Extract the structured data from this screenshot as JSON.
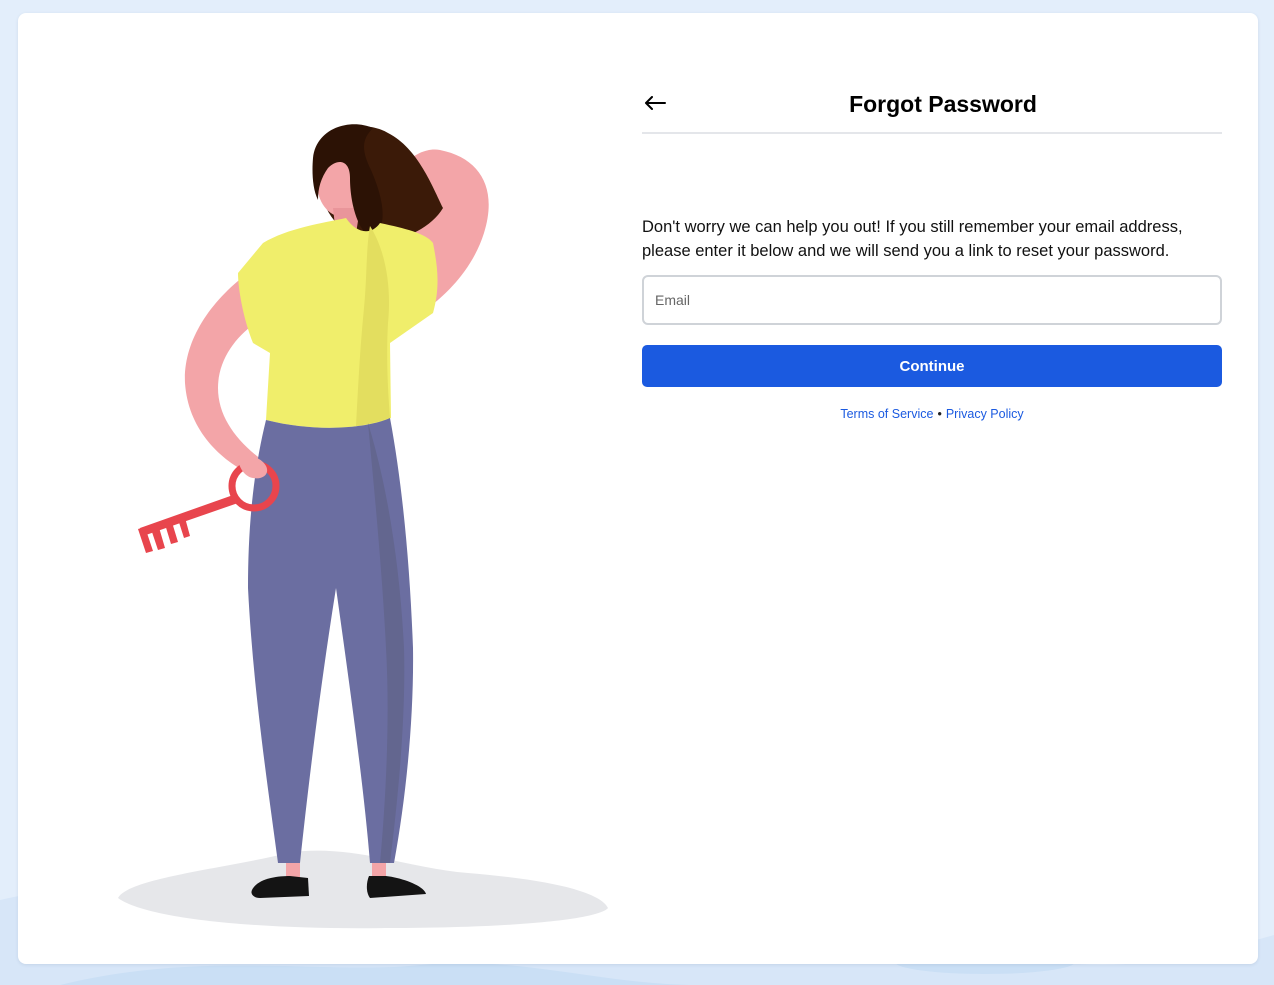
{
  "page": {
    "title": "Forgot Password",
    "back_icon": "arrow-left-icon"
  },
  "form": {
    "description": "Don't worry we can help you out! If you still remember your email address, please enter it below and we will send you a link to reset your password.",
    "email_placeholder": "Email",
    "email_value": "",
    "continue_label": "Continue"
  },
  "footer": {
    "terms_label": "Terms of Service",
    "separator": "•",
    "privacy_label": "Privacy Policy"
  },
  "colors": {
    "accent": "#1b5ae0",
    "background": "#e3eefb",
    "card": "#ffffff"
  }
}
